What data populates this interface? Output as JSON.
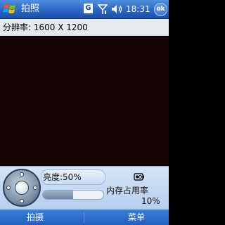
{
  "title_bar": {
    "app_title": "拍照",
    "start_icon": "windows-flag-icon",
    "network_badge": "G",
    "signal_icon": "signal-icon",
    "volume_icon": "speaker-icon",
    "time": "18:31",
    "ok_label": "ok"
  },
  "resolution": {
    "label": "分辨率: 1600 X 1200"
  },
  "controls": {
    "brightness_label": "亮度:50%",
    "brightness_level_percent": 50,
    "memory_label": "内存占用率",
    "memory_value": "10%",
    "nav_pad_icon": "directional-pad-icon",
    "camera_status_icon": "battery-icon"
  },
  "softkeys": {
    "left": "拍摄",
    "right": "菜单"
  },
  "colors": {
    "title_blue": "#2a66c4",
    "viewfinder": "#170407",
    "panel": "#c4d8f2"
  }
}
